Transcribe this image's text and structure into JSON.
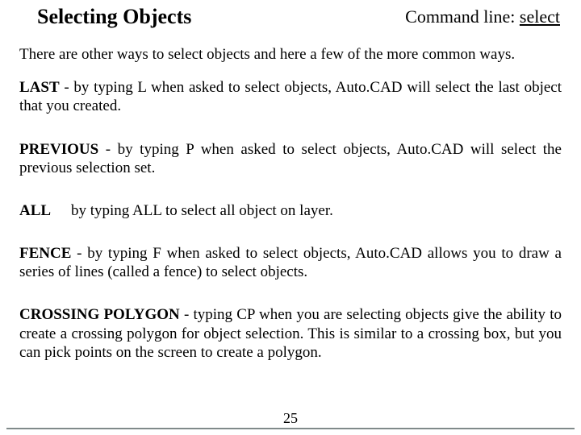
{
  "header": {
    "title": "Selecting Objects",
    "cmdline_prefix": "Command line: ",
    "cmdline_cmd": "select"
  },
  "intro": "There are other ways to select objects and here a few of the more common ways.",
  "items": {
    "last": {
      "kw": "LAST",
      "text": " - by typing L when asked to select objects, Auto.CAD will select the last object that you created."
    },
    "previous": {
      "kw": "PREVIOUS",
      "text": " - by typing P when asked to select objects, Auto.CAD will select the previous selection set."
    },
    "all": {
      "kw": "ALL",
      "text": "by typing ALL to select all object on layer."
    },
    "fence": {
      "kw": "FENCE",
      "text": " - by typing F when asked to select objects, Auto.CAD allows you to draw a series of lines (called a fence) to select objects."
    },
    "cp": {
      "kw": "CROSSING POLYGON",
      "text": " - typing CP when you are selecting objects give the ability to create a crossing polygon for object selection. This is similar to a crossing box, but you can pick points on the screen to create a polygon."
    }
  },
  "page_number": "25"
}
